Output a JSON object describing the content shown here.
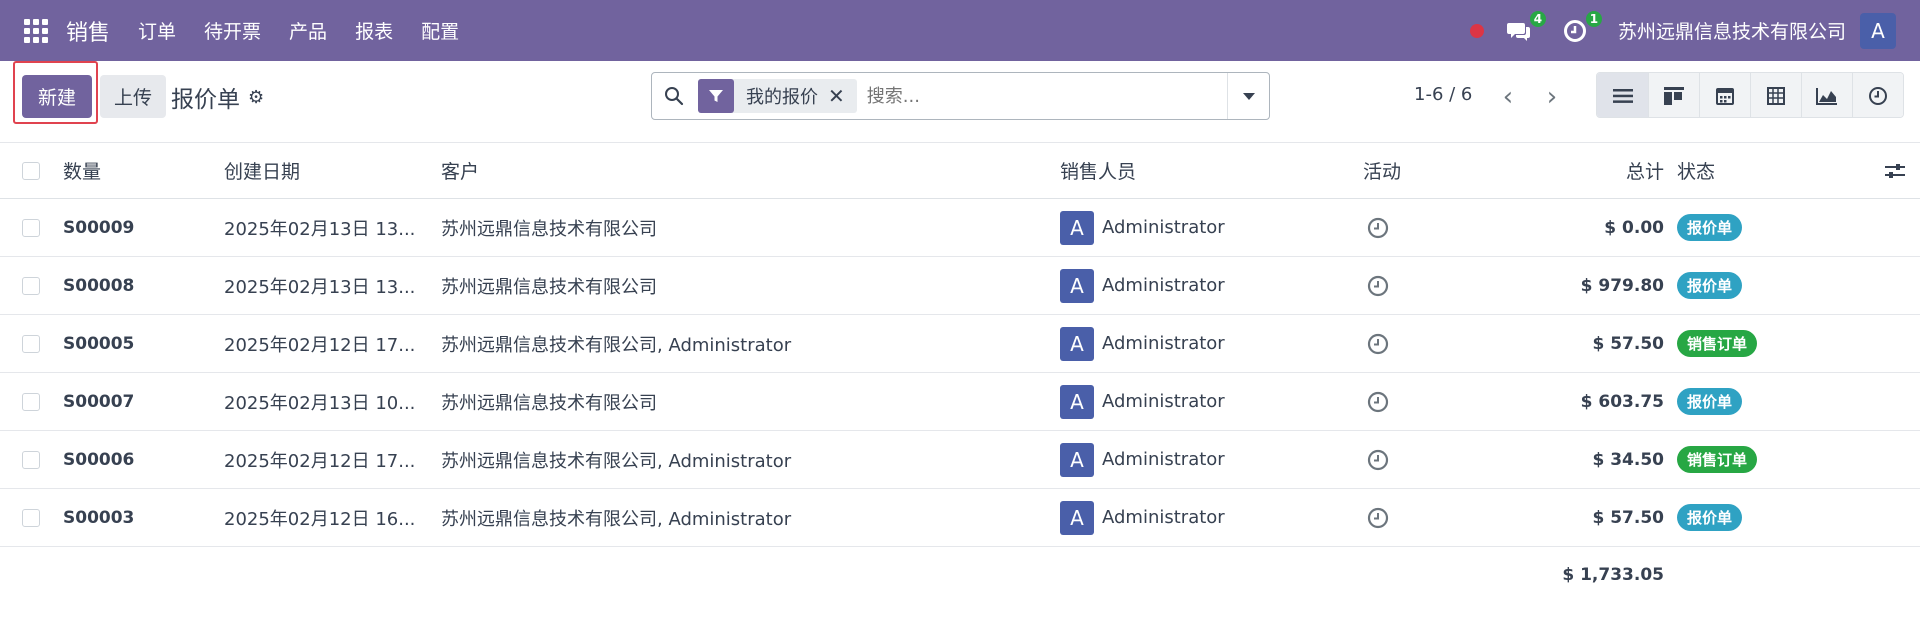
{
  "nav": {
    "app_name": "销售",
    "menu": [
      "订单",
      "待开票",
      "产品",
      "报表",
      "配置"
    ],
    "messages_count": "4",
    "activities_count": "1",
    "company": "苏州远鼎信息技术有限公司",
    "user_initial": "A"
  },
  "control": {
    "new_label": "新建",
    "upload_label": "上传",
    "breadcrumb": "报价单",
    "filter_facet": "我的报价",
    "search_placeholder": "搜索...",
    "pager": "1-6 / 6"
  },
  "table": {
    "headers": [
      "数量",
      "创建日期",
      "客户",
      "销售人员",
      "活动",
      "总计",
      "状态"
    ],
    "rows": [
      {
        "number": "S00009",
        "date": "2025年02月13日 13...",
        "customer": "苏州远鼎信息技术有限公司",
        "salesperson": "Administrator",
        "initial": "A",
        "total": "$ 0.00",
        "status": "报价单",
        "status_type": "quote"
      },
      {
        "number": "S00008",
        "date": "2025年02月13日 13...",
        "customer": "苏州远鼎信息技术有限公司",
        "salesperson": "Administrator",
        "initial": "A",
        "total": "$ 979.80",
        "status": "报价单",
        "status_type": "quote"
      },
      {
        "number": "S00005",
        "date": "2025年02月12日 17...",
        "customer": "苏州远鼎信息技术有限公司, Administrator",
        "salesperson": "Administrator",
        "initial": "A",
        "total": "$ 57.50",
        "status": "销售订单",
        "status_type": "order"
      },
      {
        "number": "S00007",
        "date": "2025年02月13日 10...",
        "customer": "苏州远鼎信息技术有限公司",
        "salesperson": "Administrator",
        "initial": "A",
        "total": "$ 603.75",
        "status": "报价单",
        "status_type": "quote"
      },
      {
        "number": "S00006",
        "date": "2025年02月12日 17...",
        "customer": "苏州远鼎信息技术有限公司, Administrator",
        "salesperson": "Administrator",
        "initial": "A",
        "total": "$ 34.50",
        "status": "销售订单",
        "status_type": "order"
      },
      {
        "number": "S00003",
        "date": "2025年02月12日 16...",
        "customer": "苏州远鼎信息技术有限公司, Administrator",
        "salesperson": "Administrator",
        "initial": "A",
        "total": "$ 57.50",
        "status": "报价单",
        "status_type": "quote"
      }
    ],
    "grand_total": "$ 1,733.05"
  },
  "colors": {
    "brand": "#71639e",
    "quote_badge": "#2fa2c3",
    "order_badge": "#27a744",
    "avatar": "#4a5fa9",
    "highlight": "#e0434f"
  }
}
